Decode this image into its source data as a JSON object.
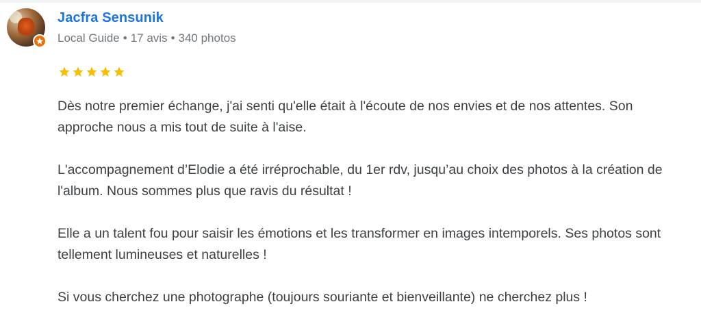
{
  "review": {
    "author": {
      "name": "Jacfra Sensunik",
      "level": "Local Guide",
      "reviews_count": "17 avis",
      "photos_count": "340 photos",
      "separator": "•"
    },
    "rating": 5,
    "rating_max": 5,
    "star_color": "#fbbc04",
    "paragraphs": [
      "Dès notre premier échange, j'ai senti qu'elle était à l'écoute de nos envies et de nos attentes. Son approche nous a mis tout de suite à l'aise.",
      "L'accompagnement d’Elodie a été irréprochable, du 1er rdv, jusqu’au choix des photos à la création de l'album. Nous sommes plus que ravis du résultat !",
      "Elle a un talent fou pour saisir les émotions et les transformer en images intemporels. Ses photos sont tellement lumineuses et naturelles !",
      "Si vous cherchez une photographe (toujours souriante et bienveillante) ne cherchez plus !"
    ]
  },
  "colors": {
    "name_link": "#1a73e8",
    "meta_text": "#70757a",
    "body_text": "#3c4043",
    "local_guide_badge": "#e8710a"
  },
  "icons": {
    "avatar": "user-avatar",
    "badge": "local-guide-star-badge",
    "star": "star-icon"
  }
}
